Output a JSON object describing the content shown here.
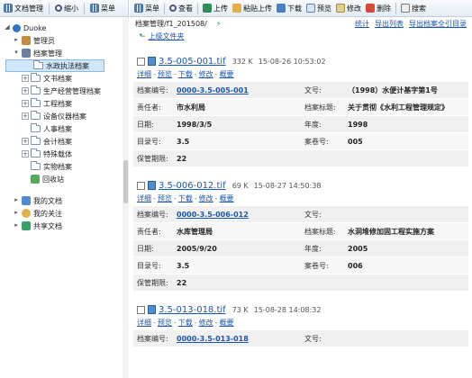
{
  "left_toolbar": {
    "items": [
      {
        "label": "文档管理",
        "icon": "doc-manage-icon"
      },
      {
        "label": "缩小",
        "icon": "shrink-icon"
      },
      {
        "label": "菜单",
        "icon": "menu-icon"
      }
    ]
  },
  "tree": {
    "root": "Duoke",
    "nodes": [
      {
        "label": "管理员",
        "level": 1,
        "toggle": "▸"
      },
      {
        "label": "档案管理",
        "level": 1,
        "toggle": "▾"
      },
      {
        "label": "水政执法档案",
        "level": 2,
        "toggle": "",
        "selected": true
      },
      {
        "label": "文书档案",
        "level": 2,
        "toggle": "+"
      },
      {
        "label": "生产经营管理档案",
        "level": 2,
        "toggle": "+"
      },
      {
        "label": "工程档案",
        "level": 2,
        "toggle": "+"
      },
      {
        "label": "设备仪器档案",
        "level": 2,
        "toggle": "+"
      },
      {
        "label": "人事档案",
        "level": 2,
        "toggle": ""
      },
      {
        "label": "会计档案",
        "level": 2,
        "toggle": "+"
      },
      {
        "label": "特殊载体",
        "level": 2,
        "toggle": "+"
      },
      {
        "label": "实物档案",
        "level": 2,
        "toggle": ""
      },
      {
        "label": "回收站",
        "level": 2,
        "toggle": ""
      }
    ],
    "bottom_nodes": [
      {
        "label": "我的文档",
        "toggle": "▸"
      },
      {
        "label": "我的关注",
        "toggle": "▸"
      },
      {
        "label": "共享文档",
        "toggle": "▸"
      }
    ]
  },
  "right_toolbar": {
    "items": [
      {
        "label": "菜单"
      },
      {
        "label": "查看"
      },
      {
        "label": "上传"
      },
      {
        "label": "粘贴上传"
      },
      {
        "label": "下载"
      },
      {
        "label": "预览"
      },
      {
        "label": "修改"
      },
      {
        "label": "删除"
      },
      {
        "label": "搜索"
      }
    ]
  },
  "path": {
    "current": "档案管理/f1_201508/",
    "refresh_symbol": "⚡",
    "links": [
      "统计",
      "导出列表",
      "导出档案全引目录"
    ],
    "up_folder": "上级文件夹"
  },
  "records": [
    {
      "name": "3.5-005-001.tif",
      "size": "332 K",
      "date": "15-08-26 10:53:02",
      "actions": [
        "详细",
        "预览",
        "下载",
        "修改",
        "概要"
      ],
      "fields": [
        {
          "l1": "档案编号:",
          "v1": "0000-3.5-005-001",
          "v1link": true,
          "l2": "文号:",
          "v2": "（1998）水便计基字第1号"
        },
        {
          "l1": "责任者:",
          "v1": "市水利局",
          "l2": "档案标题:",
          "v2": "关于贯彻《水利工程管理规定》"
        },
        {
          "l1": "日期:",
          "v1": "1998/3/5",
          "l2": "年度:",
          "v2": "1998"
        },
        {
          "l1": "目录号:",
          "v1": "3.5",
          "l2": "案卷号:",
          "v2": "005"
        },
        {
          "l1": "保管期限:",
          "v1": "22",
          "l2": "",
          "v2": ""
        }
      ]
    },
    {
      "name": "3.5-006-012.tif",
      "size": "69 K",
      "date": "15-08-27 14:50:38",
      "actions": [
        "详细",
        "预览",
        "下载",
        "修改",
        "概要"
      ],
      "fields": [
        {
          "l1": "档案编号:",
          "v1": "0000-3.5-006-012",
          "v1link": true,
          "l2": "文号:",
          "v2": ""
        },
        {
          "l1": "责任者:",
          "v1": "水库管理局",
          "l2": "档案标题:",
          "v2": "水洞堆修加固工程实施方案"
        },
        {
          "l1": "日期:",
          "v1": "2005/9/20",
          "l2": "年度:",
          "v2": "2005"
        },
        {
          "l1": "目录号:",
          "v1": "3.5",
          "l2": "案卷号:",
          "v2": "006"
        },
        {
          "l1": "保管期限:",
          "v1": "22",
          "l2": "",
          "v2": ""
        }
      ]
    },
    {
      "name": "3.5-013-018.tif",
      "size": "73 K",
      "date": "15-08-28 14:08:32",
      "actions": [
        "详细",
        "预览",
        "下载",
        "修改",
        "概要"
      ],
      "fields": [
        {
          "l1": "档案编号:",
          "v1": "0000-3.5-013-018",
          "v1link": true,
          "l2": "文号:",
          "v2": ""
        }
      ]
    }
  ]
}
